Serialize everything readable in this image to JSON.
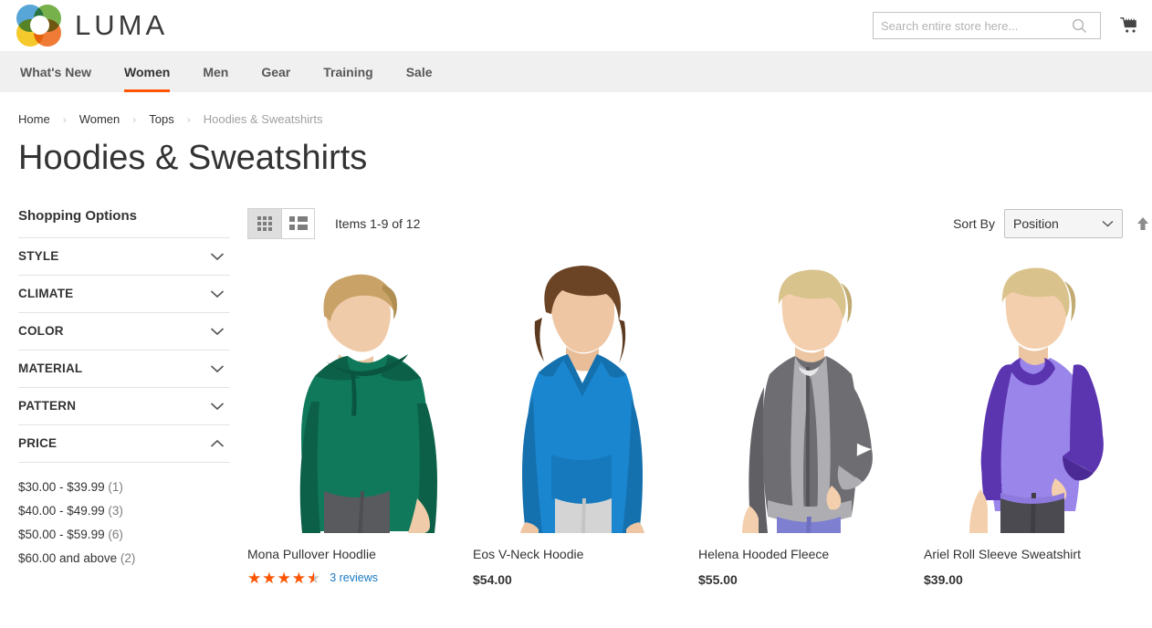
{
  "header": {
    "logo_text": "LUMA",
    "logo_icon": "luma-rings-logo",
    "search": {
      "placeholder": "Search entire store here...",
      "value": "",
      "icon": "search-icon"
    },
    "cart_icon": "shopping-cart-icon"
  },
  "nav": {
    "items": [
      {
        "label": "What's New",
        "active": false
      },
      {
        "label": "Women",
        "active": true
      },
      {
        "label": "Men",
        "active": false
      },
      {
        "label": "Gear",
        "active": false
      },
      {
        "label": "Training",
        "active": false
      },
      {
        "label": "Sale",
        "active": false
      }
    ],
    "active_color": "#ff5501"
  },
  "breadcrumb": {
    "items": [
      "Home",
      "Women",
      "Tops",
      "Hoodies & Sweatshirts"
    ],
    "separator": "›"
  },
  "page_title": "Hoodies & Sweatshirts",
  "sidebar": {
    "title": "Shopping Options",
    "filters": [
      {
        "label": "STYLE",
        "expanded": false,
        "icon": "chevron-down-icon"
      },
      {
        "label": "CLIMATE",
        "expanded": false,
        "icon": "chevron-down-icon"
      },
      {
        "label": "COLOR",
        "expanded": false,
        "icon": "chevron-down-icon"
      },
      {
        "label": "MATERIAL",
        "expanded": false,
        "icon": "chevron-down-icon"
      },
      {
        "label": "PATTERN",
        "expanded": false,
        "icon": "chevron-down-icon"
      },
      {
        "label": "PRICE",
        "expanded": true,
        "icon": "chevron-up-icon"
      }
    ],
    "price_options": [
      {
        "range": "$30.00 - $39.99",
        "count": "(1)"
      },
      {
        "range": "$40.00 - $49.99",
        "count": "(3)"
      },
      {
        "range": "$50.00 - $59.99",
        "count": "(6)"
      },
      {
        "range": "$60.00 and above",
        "count": "(2)"
      }
    ]
  },
  "toolbar": {
    "grid_mode_icon": "grid-view-icon",
    "list_mode_icon": "list-view-icon",
    "active_mode": "grid",
    "items_count": "Items 1-9 of 12",
    "sort_label": "Sort By",
    "sort_value": "Position",
    "sort_chevron_icon": "chevron-down-icon",
    "sort_direction_icon": "arrow-up-icon"
  },
  "products": [
    {
      "name": "Mona Pullover Hoodlie",
      "price": "",
      "rating_percent": 90,
      "stars_filled": "★★★★★",
      "stars_empty": "★★★★★",
      "reviews": "3 reviews",
      "image": "woman-green-pullover-hoodie",
      "colors": {
        "garment": "#10795c",
        "garment_dark": "#0c6047",
        "pants": "#585a5e",
        "hair": "#c9a267",
        "skin": "#f0cba9"
      }
    },
    {
      "name": "Eos V-Neck Hoodie",
      "price": "$54.00",
      "rating_percent": 0,
      "reviews": "",
      "image": "woman-blue-vneck-hoodie",
      "colors": {
        "garment": "#1a86cf",
        "garment_dark": "#1570ae",
        "pants": "#d4d4d4",
        "hair": "#6b4426",
        "skin": "#eec6a4"
      }
    },
    {
      "name": "Helena Hooded Fleece",
      "price": "$55.00",
      "rating_percent": 0,
      "reviews": "",
      "image": "woman-grey-hooded-fleece",
      "colors": {
        "garment": "#6e6e72",
        "garment_dark": "#5a5a5e",
        "trim": "#aeaeb2",
        "pants": "#7f7fd1",
        "hair": "#d8c38d",
        "skin": "#f3cfae"
      }
    },
    {
      "name": "Ariel Roll Sleeve Sweatshirt",
      "price": "$39.00",
      "rating_percent": 0,
      "reviews": "",
      "image": "woman-purple-roll-sleeve-sweatshirt",
      "colors": {
        "garment": "#9a85ea",
        "garment_dark": "#5b34b0",
        "pants": "#4a4a50",
        "hair": "#d9c28c",
        "skin": "#f3cfae"
      }
    }
  ]
}
